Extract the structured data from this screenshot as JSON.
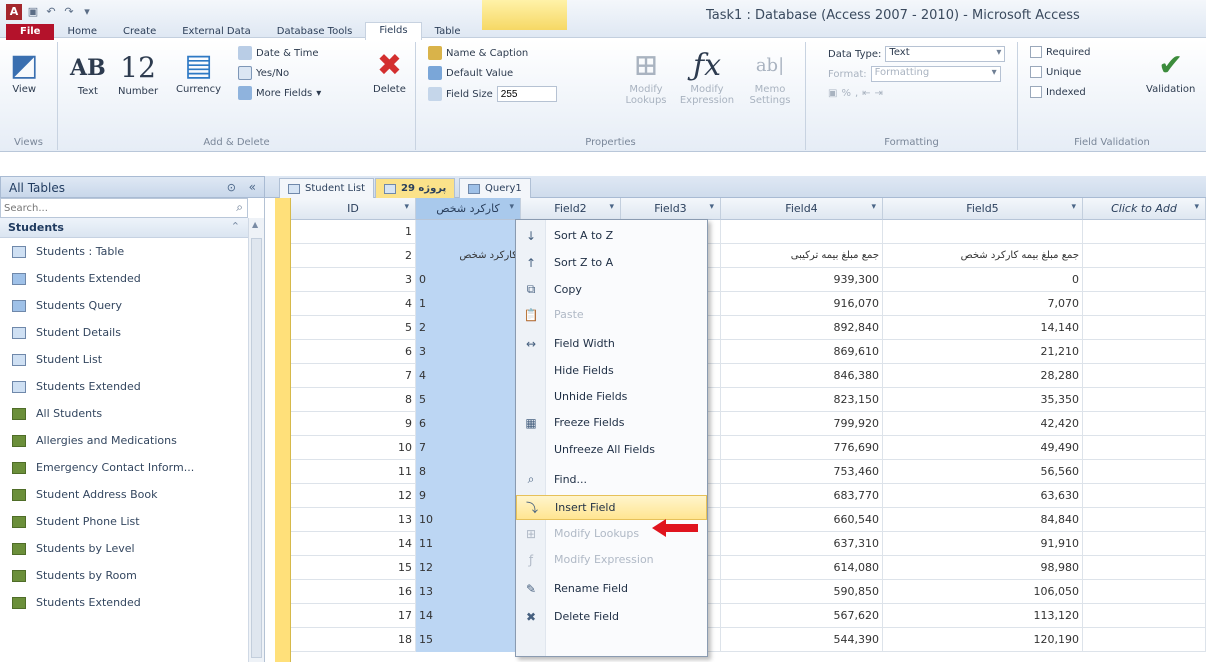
{
  "window": {
    "title": "Task1 : Database (Access 2007 - 2010)  -  Microsoft Access"
  },
  "quick_access": {
    "app_letter": "A",
    "icons": [
      "save-icon",
      "undo-icon",
      "redo-icon",
      "customize-icon"
    ]
  },
  "ribbon_tabs": [
    "File",
    "Home",
    "Create",
    "External Data",
    "Database Tools",
    "Fields",
    "Table"
  ],
  "ribbon": {
    "views": {
      "view_label": "View",
      "group_label": "Views"
    },
    "add_delete": {
      "text_label": "Text",
      "number_label": "Number",
      "currency_label": "Currency",
      "date_time_label": "Date & Time",
      "yes_no_label": "Yes/No",
      "more_fields_label": "More Fields",
      "delete_label": "Delete",
      "group_label": "Add & Delete"
    },
    "properties": {
      "name_caption_label": "Name & Caption",
      "default_value_label": "Default Value",
      "field_size_label": "Field Size",
      "field_size_value": "255",
      "modify_lookups_label": "Modify Lookups",
      "modify_expression_label": "Modify Expression",
      "memo_settings_label": "Memo Settings",
      "group_label": "Properties"
    },
    "formatting": {
      "data_type_label": "Data Type:",
      "data_type_value": "Text",
      "format_label": "Format:",
      "format_value": "Formatting",
      "group_label": "Formatting"
    },
    "validation": {
      "required_label": "Required",
      "unique_label": "Unique",
      "indexed_label": "Indexed",
      "validation_label": "Validation",
      "group_label": "Field Validation"
    }
  },
  "nav": {
    "header": "All Tables",
    "search_placeholder": "Search...",
    "group": "Students",
    "items": [
      {
        "label": "Students : Table",
        "kind": "table"
      },
      {
        "label": "Students Extended",
        "kind": "form"
      },
      {
        "label": "Students Query",
        "kind": "form"
      },
      {
        "label": "Student Details",
        "kind": "table"
      },
      {
        "label": "Student List",
        "kind": "table"
      },
      {
        "label": "Students Extended",
        "kind": "table"
      },
      {
        "label": "All Students",
        "kind": "report"
      },
      {
        "label": "Allergies and Medications",
        "kind": "report"
      },
      {
        "label": "Emergency Contact Inform...",
        "kind": "report"
      },
      {
        "label": "Student Address Book",
        "kind": "report"
      },
      {
        "label": "Student Phone List",
        "kind": "report"
      },
      {
        "label": "Students by Level",
        "kind": "report"
      },
      {
        "label": "Students by Room",
        "kind": "report"
      },
      {
        "label": "Students Extended",
        "kind": "report"
      }
    ]
  },
  "doc_tabs": [
    "Student List",
    "پروژه 29",
    "Query1"
  ],
  "sheet": {
    "headers": [
      "ID",
      "کارکرد شخص",
      "Field2",
      "Field3",
      "Field4",
      "Field5",
      "Click to Add"
    ],
    "rows": [
      {
        "id": "1",
        "c1": "",
        "f4": "",
        "f5": ""
      },
      {
        "id": "2",
        "c1": "کارکرد شخص",
        "f4": "جمع مبلغ بیمه ترکیبی",
        "f5": "جمع مبلغ بیمه کارکرد شخص"
      },
      {
        "id": "3",
        "c1": "0",
        "f4": "939,300",
        "f5": "0"
      },
      {
        "id": "4",
        "c1": "1",
        "f4": "916,070",
        "f5": "7,070"
      },
      {
        "id": "5",
        "c1": "2",
        "f4": "892,840",
        "f5": "14,140"
      },
      {
        "id": "6",
        "c1": "3",
        "f4": "869,610",
        "f5": "21,210"
      },
      {
        "id": "7",
        "c1": "4",
        "f4": "846,380",
        "f5": "28,280"
      },
      {
        "id": "8",
        "c1": "5",
        "f4": "823,150",
        "f5": "35,350"
      },
      {
        "id": "9",
        "c1": "6",
        "f4": "799,920",
        "f5": "42,420"
      },
      {
        "id": "10",
        "c1": "7",
        "f4": "776,690",
        "f5": "49,490"
      },
      {
        "id": "11",
        "c1": "8",
        "f4": "753,460",
        "f5": "56,560"
      },
      {
        "id": "12",
        "c1": "9",
        "f4": "683,770",
        "f5": "63,630"
      },
      {
        "id": "13",
        "c1": "10",
        "f4": "660,540",
        "f5": "84,840"
      },
      {
        "id": "14",
        "c1": "11",
        "f4": "637,310",
        "f5": "91,910"
      },
      {
        "id": "15",
        "c1": "12",
        "f4": "614,080",
        "f5": "98,980"
      },
      {
        "id": "16",
        "c1": "13",
        "f4": "590,850",
        "f5": "106,050"
      },
      {
        "id": "17",
        "c1": "14",
        "f4": "567,620",
        "f5": "113,120"
      },
      {
        "id": "18",
        "c1": "15",
        "f4": "544,390",
        "f5": "120,190"
      }
    ]
  },
  "context_menu": [
    {
      "label": "Sort A to Z",
      "icon": "sort-asc-icon",
      "glyph": "↓",
      "disabled": false
    },
    {
      "label": "Sort Z to A",
      "icon": "sort-desc-icon",
      "glyph": "↑",
      "disabled": false
    },
    {
      "label": "Copy",
      "icon": "copy-icon",
      "glyph": "⧉",
      "disabled": false
    },
    {
      "label": "Paste",
      "icon": "paste-icon",
      "glyph": "📋",
      "disabled": true
    },
    {
      "label": "Field Width",
      "icon": "field-width-icon",
      "glyph": "↔",
      "disabled": false
    },
    {
      "label": "Hide Fields",
      "icon": "",
      "glyph": "",
      "disabled": false
    },
    {
      "label": "Unhide Fields",
      "icon": "",
      "glyph": "",
      "disabled": false
    },
    {
      "label": "Freeze Fields",
      "icon": "freeze-icon",
      "glyph": "▦",
      "disabled": false
    },
    {
      "label": "Unfreeze All Fields",
      "icon": "",
      "glyph": "",
      "disabled": false
    },
    {
      "label": "Find...",
      "icon": "find-icon",
      "glyph": "⌕",
      "disabled": false
    },
    {
      "label": "Insert Field",
      "icon": "insert-field-icon",
      "glyph": "⤵",
      "disabled": false,
      "highlighted": true
    },
    {
      "label": "Modify Lookups",
      "icon": "lookup-icon",
      "glyph": "⊞",
      "disabled": true
    },
    {
      "label": "Modify Expression",
      "icon": "expression-icon",
      "glyph": "ƒ",
      "disabled": true
    },
    {
      "label": "Rename Field",
      "icon": "rename-icon",
      "glyph": "✎",
      "disabled": false
    },
    {
      "label": "Delete Field",
      "icon": "delete-field-icon",
      "glyph": "✖",
      "disabled": false
    }
  ],
  "colors": {
    "file_tab": "#b4122b",
    "selection_column": "#bcd6f3",
    "record_selector": "#ffe07a",
    "arrow": "#e0141e"
  }
}
